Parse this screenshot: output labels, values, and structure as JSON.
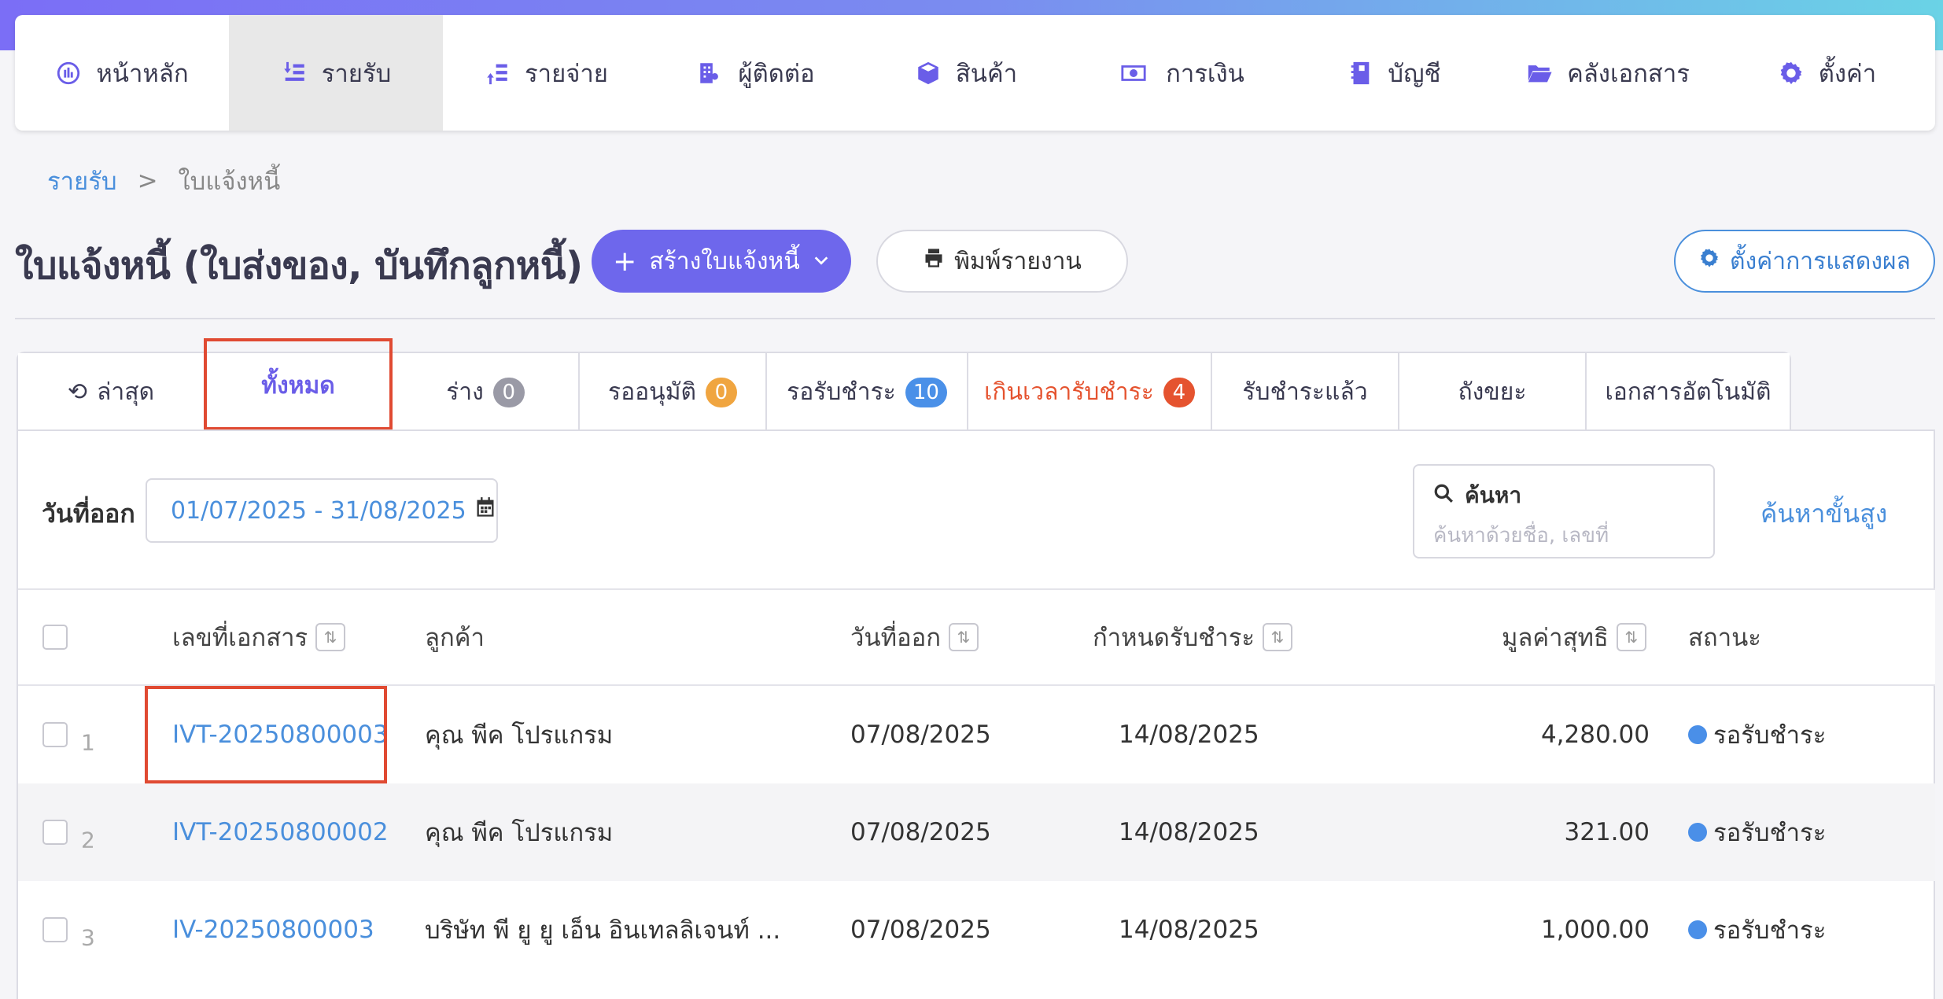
{
  "nav": {
    "items": [
      {
        "label": "หน้าหลัก",
        "icon": "dashboard-icon"
      },
      {
        "label": "รายรับ",
        "icon": "income-icon",
        "active": true
      },
      {
        "label": "รายจ่าย",
        "icon": "expense-icon"
      },
      {
        "label": "ผู้ติดต่อ",
        "icon": "contacts-icon"
      },
      {
        "label": "สินค้า",
        "icon": "box-icon"
      },
      {
        "label": "การเงิน",
        "icon": "money-icon"
      },
      {
        "label": "บัญชี",
        "icon": "book-icon"
      },
      {
        "label": "คลังเอกสาร",
        "icon": "folder-icon"
      },
      {
        "label": "ตั้งค่า",
        "icon": "gear-icon"
      }
    ]
  },
  "breadcrumb": {
    "parent": "รายรับ",
    "sep": ">",
    "current": "ใบแจ้งหนี้"
  },
  "page": {
    "title": "ใบแจ้งหนี้ (ใบส่งของ, บันทึกลูกหนี้)",
    "create_label": "สร้างใบแจ้งหนี้",
    "print_label": "พิมพ์รายงาน",
    "display_settings_label": "ตั้งค่าการแสดงผล"
  },
  "tabs": [
    {
      "label": "ล่าสุด"
    },
    {
      "label": "ทั้งหมด",
      "active": true
    },
    {
      "label": "ร่าง",
      "count": "0",
      "badge_color": "#9a9aa6"
    },
    {
      "label": "รออนุมัติ",
      "count": "0",
      "badge_color": "#f0a540"
    },
    {
      "label": "รอรับชำระ",
      "count": "10",
      "badge_color": "#4a90e8"
    },
    {
      "label": "เกินเวลารับชำระ",
      "count": "4",
      "badge_color": "#e5532f"
    },
    {
      "label": "รับชำระแล้ว"
    },
    {
      "label": "ถังขยะ"
    },
    {
      "label": "เอกสารอัตโนมัติ"
    }
  ],
  "filter": {
    "date_label": "วันที่ออก",
    "date_range": "01/07/2025 - 31/08/2025",
    "search_label": "ค้นหา",
    "search_placeholder": "ค้นหาด้วยชื่อ, เลขที่",
    "advanced_search": "ค้นหาขั้นสูง"
  },
  "table": {
    "headers": {
      "doc_no": "เลขที่เอกสาร",
      "customer": "ลูกค้า",
      "issue_date": "วันที่ออก",
      "due_date": "กำหนดรับชำระ",
      "net": "มูลค่าสุทธิ",
      "status": "สถานะ"
    },
    "rows": [
      {
        "num": "1",
        "doc_no": "IVT-20250800003",
        "customer": "คุณ พีค โปรแกรม",
        "issue_date": "07/08/2025",
        "due_date": "14/08/2025",
        "net": "4,280.00",
        "status": "รอรับชำระ"
      },
      {
        "num": "2",
        "doc_no": "IVT-20250800002",
        "customer": "คุณ พีค โปรแกรม",
        "issue_date": "07/08/2025",
        "due_date": "14/08/2025",
        "net": "321.00",
        "status": "รอรับชำระ"
      },
      {
        "num": "3",
        "doc_no": "IV-20250800003",
        "customer": "บริษัท พี ยู ยู เอ็น อินเทลลิเจนท์ ...",
        "issue_date": "07/08/2025",
        "due_date": "14/08/2025",
        "net": "1,000.00",
        "status": "รอรับชำระ"
      }
    ]
  },
  "colors": {
    "accent": "#6e67ec",
    "link": "#4a8fdc",
    "danger": "#e5532f",
    "highlight": "#e04a32"
  }
}
